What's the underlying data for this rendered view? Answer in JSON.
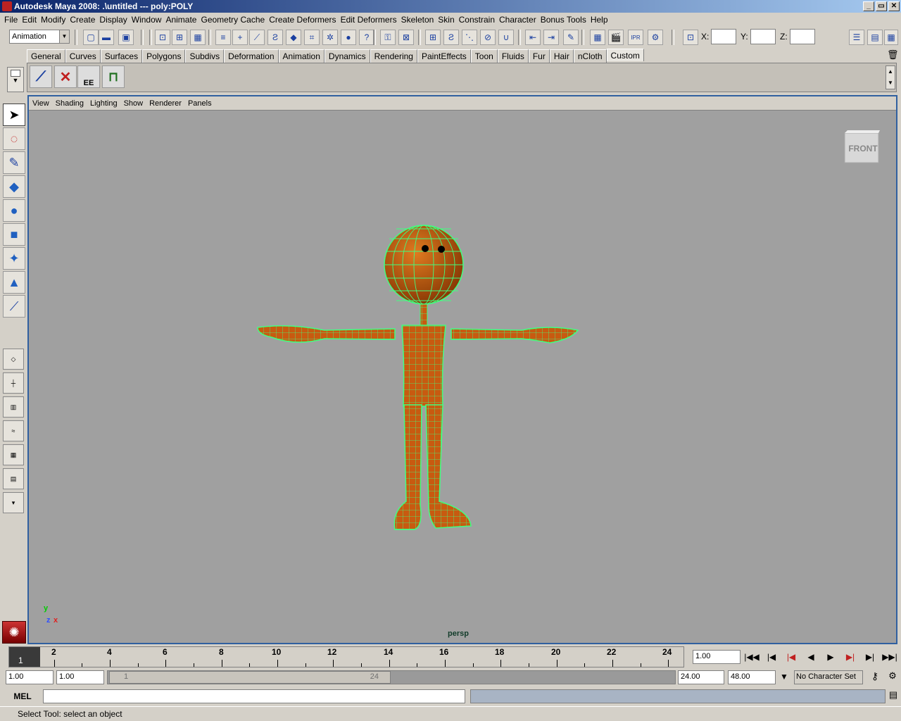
{
  "window": {
    "title": "Autodesk Maya 2008: .\\untitled  ---  poly:POLY",
    "buttons": [
      "_",
      "▭",
      "✕"
    ]
  },
  "menu": [
    "File",
    "Edit",
    "Modify",
    "Create",
    "Display",
    "Window",
    "Animate",
    "Geometry Cache",
    "Create Deformers",
    "Edit Deformers",
    "Skeleton",
    "Skin",
    "Constrain",
    "Character",
    "Bonus Tools",
    "Help"
  ],
  "statusline": {
    "mode": "Animation",
    "x_label": "X:",
    "y_label": "Y:",
    "z_label": "Z:",
    "x": "",
    "y": "",
    "z": ""
  },
  "shelf": {
    "tabs": [
      "General",
      "Curves",
      "Surfaces",
      "Polygons",
      "Subdivs",
      "Deformation",
      "Animation",
      "Dynamics",
      "Rendering",
      "PaintEffects",
      "Toon",
      "Fluids",
      "Fur",
      "Hair",
      "nCloth",
      "Custom"
    ],
    "active": "Custom",
    "icon_ee_label": "EE"
  },
  "panel": {
    "menu": [
      "View",
      "Shading",
      "Lighting",
      "Show",
      "Renderer",
      "Panels"
    ],
    "camera": "persp",
    "viewcube": "FRONT",
    "axes": {
      "y": "y",
      "z": "z",
      "x": "x"
    }
  },
  "timeline": {
    "ticks": [
      "2",
      "4",
      "6",
      "8",
      "10",
      "12",
      "14",
      "16",
      "18",
      "20",
      "22",
      "24"
    ],
    "current_frame": "1",
    "current_time": "1.00"
  },
  "range": {
    "start": "1.00",
    "playback_start": "1.00",
    "handle_start": "1",
    "handle_end": "24",
    "playback_end": "24.00",
    "end": "48.00",
    "character_set": "No Character Set"
  },
  "command": {
    "mel_label": "MEL",
    "input": ""
  },
  "help": {
    "text": "Select Tool: select an object"
  },
  "colors": {
    "accent": "#3060a0",
    "mesh_fill": "#c85a10",
    "wireframe": "#40ff80",
    "viewport_bg": "#a0a0a0"
  }
}
